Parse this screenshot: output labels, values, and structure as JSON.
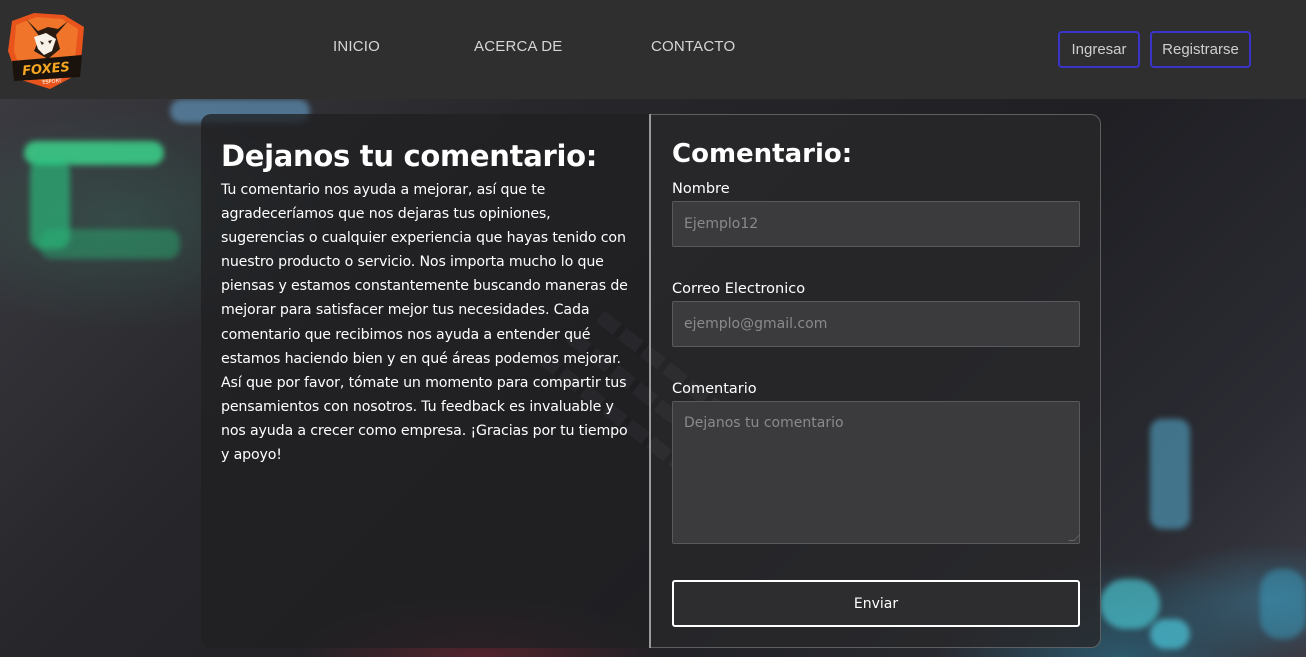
{
  "brand": {
    "logo_text": "FOXES",
    "logo_subtext": "ESPORT"
  },
  "nav": {
    "items": [
      {
        "label": "INICIO"
      },
      {
        "label": "ACERCA DE"
      },
      {
        "label": "CONTACTO"
      }
    ]
  },
  "auth": {
    "login_label": "Ingresar",
    "register_label": "Registrarse"
  },
  "info": {
    "title": "Dejanos tu comentario:",
    "body": "Tu comentario nos ayuda a mejorar, así que te agradeceríamos que nos dejaras tus opiniones, sugerencias o cualquier experiencia que hayas tenido con nuestro producto o servicio. Nos importa mucho lo que piensas y estamos constantemente buscando maneras de mejorar para satisfacer mejor tus necesidades. Cada comentario que recibimos nos ayuda a entender qué estamos haciendo bien y en qué áreas podemos mejorar. Así que por favor, tómate un momento para compartir tus pensamientos con nosotros. Tu feedback es invaluable y nos ayuda a crecer como empresa. ¡Gracias por tu tiempo y apoyo!"
  },
  "form": {
    "title": "Comentario:",
    "name_label": "Nombre",
    "name_placeholder": "Ejemplo12",
    "name_value": "",
    "email_label": "Correo Electronico",
    "email_placeholder": "ejemplo@gmail.com",
    "email_value": "",
    "comment_label": "Comentario",
    "comment_placeholder": "Dejanos tu comentario",
    "comment_value": "",
    "submit_label": "Enviar"
  },
  "colors": {
    "header_bg": "#2f2f2f",
    "auth_border": "#3a34c9",
    "panel_bg": "#202022"
  }
}
